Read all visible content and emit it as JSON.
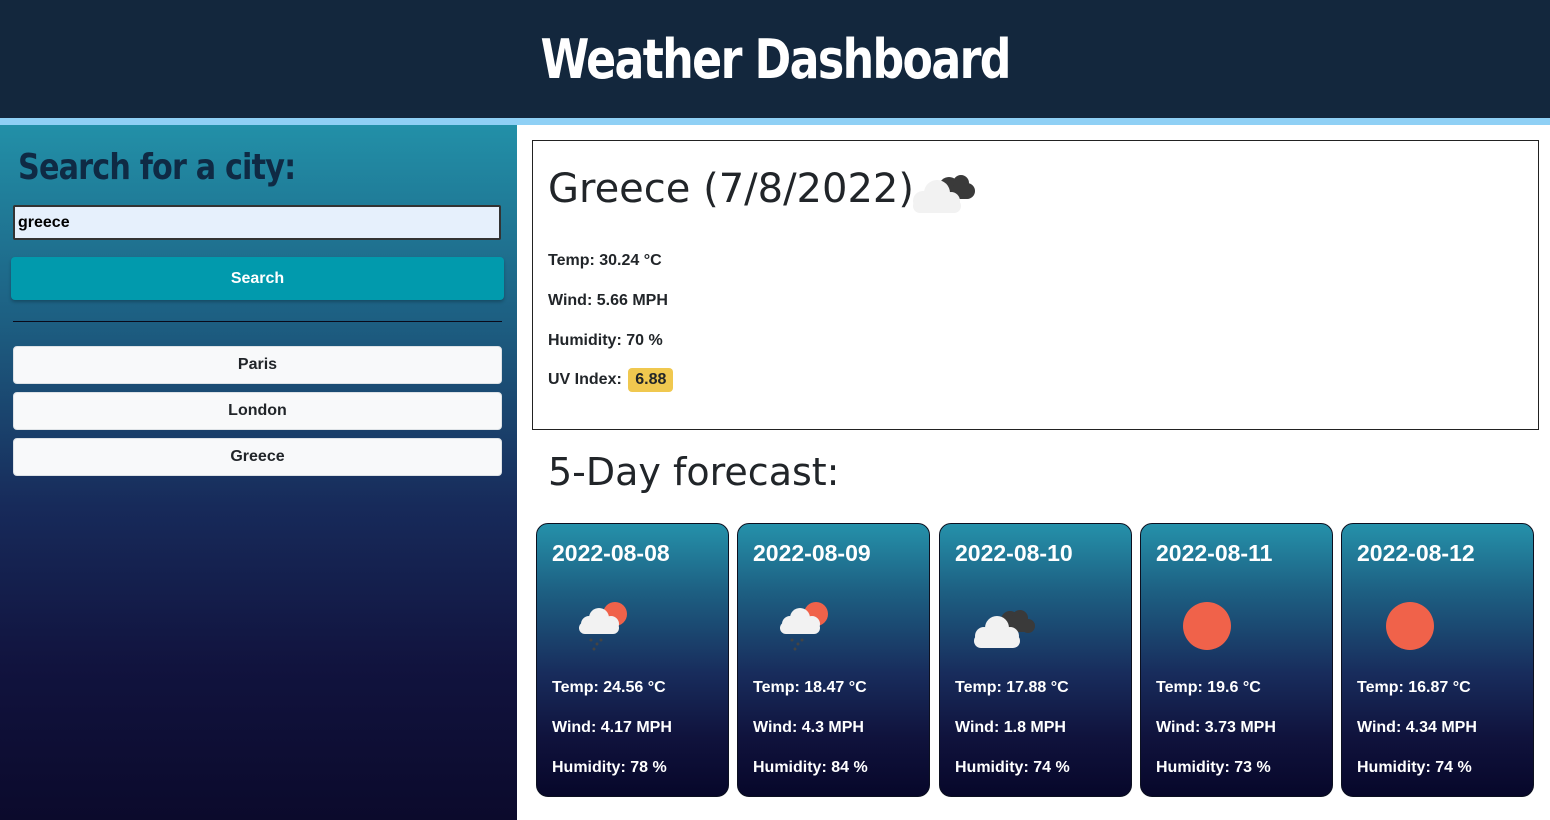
{
  "header": {
    "title": "Weather Dashboard"
  },
  "sidebar": {
    "heading": "Search for a city:",
    "search_value": "greece",
    "search_button": "Search",
    "history": [
      "Paris",
      "London",
      "Greece"
    ]
  },
  "current": {
    "title": "Greece (7/8/2022)",
    "icon": "cloudy-icon",
    "temp": "Temp: 30.24 °C",
    "wind": "Wind: 5.66 MPH",
    "humidity": "Humidity: 70 %",
    "uv_label": "UV Index:",
    "uv_value": "6.88",
    "uv_color": "#f0c84f"
  },
  "forecast": {
    "heading": "5-Day forecast:",
    "days": [
      {
        "date": "2022-08-08",
        "icon": "rain-sun-icon",
        "temp": "Temp: 24.56 °C",
        "wind": "Wind: 4.17 MPH",
        "humidity": "Humidity: 78 %"
      },
      {
        "date": "2022-08-09",
        "icon": "rain-sun-icon",
        "temp": "Temp: 18.47 °C",
        "wind": "Wind: 4.3 MPH",
        "humidity": "Humidity: 84 %"
      },
      {
        "date": "2022-08-10",
        "icon": "cloudy-icon",
        "temp": "Temp: 17.88 °C",
        "wind": "Wind: 1.8 MPH",
        "humidity": "Humidity: 74 %"
      },
      {
        "date": "2022-08-11",
        "icon": "sun-icon",
        "temp": "Temp: 19.6 °C",
        "wind": "Wind: 3.73 MPH",
        "humidity": "Humidity: 73 %"
      },
      {
        "date": "2022-08-12",
        "icon": "sun-icon",
        "temp": "Temp: 16.87 °C",
        "wind": "Wind: 4.34 MPH",
        "humidity": "Humidity: 74 %"
      }
    ]
  },
  "colors": {
    "header_bg": "#13273d",
    "accent_stripe": "#8fd0f5",
    "search_button": "#019aad",
    "sun": "#f0624a"
  }
}
